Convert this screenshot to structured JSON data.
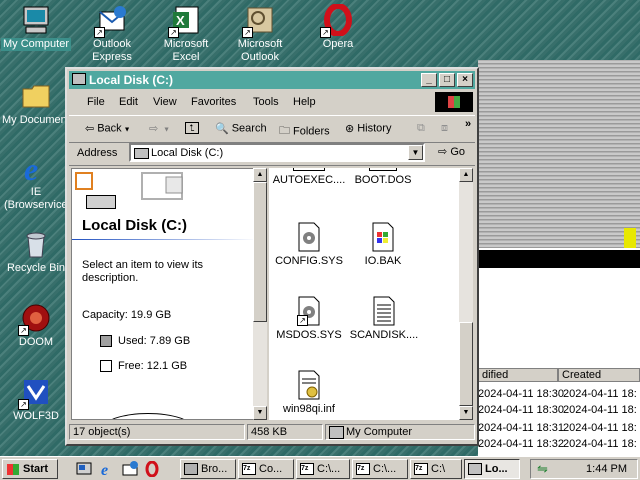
{
  "desktop": {
    "icons": [
      {
        "label": "My Computer",
        "icon": "my-computer-icon"
      },
      {
        "label": "Outlook Express",
        "icon": "outlook-express-icon"
      },
      {
        "label": "Microsoft Excel",
        "icon": "excel-icon"
      },
      {
        "label": "Microsoft Outlook",
        "icon": "outlook-icon"
      },
      {
        "label": "Opera",
        "icon": "opera-icon"
      },
      {
        "label": "My Documents",
        "icon": "folder-icon"
      },
      {
        "label": "IE (Browservice)",
        "icon": "internet-explorer-icon"
      },
      {
        "label": "Recycle Bin",
        "icon": "recycle-bin-icon"
      },
      {
        "label": "DOOM",
        "icon": "doom-icon"
      },
      {
        "label": "WOLF3D",
        "icon": "wolf3d-icon"
      }
    ],
    "bg_window": {
      "headers": [
        "dified",
        "Created"
      ],
      "rows": [
        [
          "2024-04-11 18:30",
          "2024-04-11 18:"
        ],
        [
          "2024-04-11 18:30",
          "2024-04-11 18:"
        ],
        [
          "2024-04-11 18:31",
          "2024-04-11 18:"
        ],
        [
          "2024-04-11 18:32",
          "2024-04-11 18:"
        ]
      ]
    }
  },
  "window": {
    "title": "Local Disk (C:)",
    "menu": [
      "File",
      "Edit",
      "View",
      "Favorites",
      "Tools",
      "Help"
    ],
    "toolbar": {
      "back": "Back",
      "search": "Search",
      "folders": "Folders",
      "history": "History"
    },
    "address": {
      "label": "Address",
      "value": "Local Disk (C:)",
      "go": "Go"
    },
    "left_pane": {
      "heading": "Local Disk (C:)",
      "hint": "Select an item to view its description.",
      "capacity": "Capacity: 19.9 GB",
      "used": "Used: 7.89 GB",
      "free": "Free: 12.1 GB"
    },
    "files": [
      {
        "name": "AUTOEXEC....",
        "icon": "text-file-icon"
      },
      {
        "name": "BOOT.DOS",
        "icon": "text-file-icon"
      },
      {
        "name": "CONFIG.SYS",
        "icon": "system-file-icon"
      },
      {
        "name": "IO.BAK",
        "icon": "windows-file-icon"
      },
      {
        "name": "MSDOS.SYS",
        "icon": "system-file-icon"
      },
      {
        "name": "SCANDISK....",
        "icon": "text-file-icon"
      },
      {
        "name": "win98qi.inf",
        "icon": "inf-file-icon"
      }
    ],
    "status": {
      "objects": "17 object(s)",
      "size": "458 KB",
      "zone": "My Computer"
    }
  },
  "taskbar": {
    "start": "Start",
    "tasks": [
      "Bro...",
      "Co...",
      "C:\\...",
      "C:\\...",
      "C:\\",
      "Lo..."
    ],
    "clock": "1:44 PM"
  },
  "colors": {
    "titlebar": "#50a8a0",
    "desktop": "#3a6d6a",
    "chrome": "#d4d0c8"
  }
}
